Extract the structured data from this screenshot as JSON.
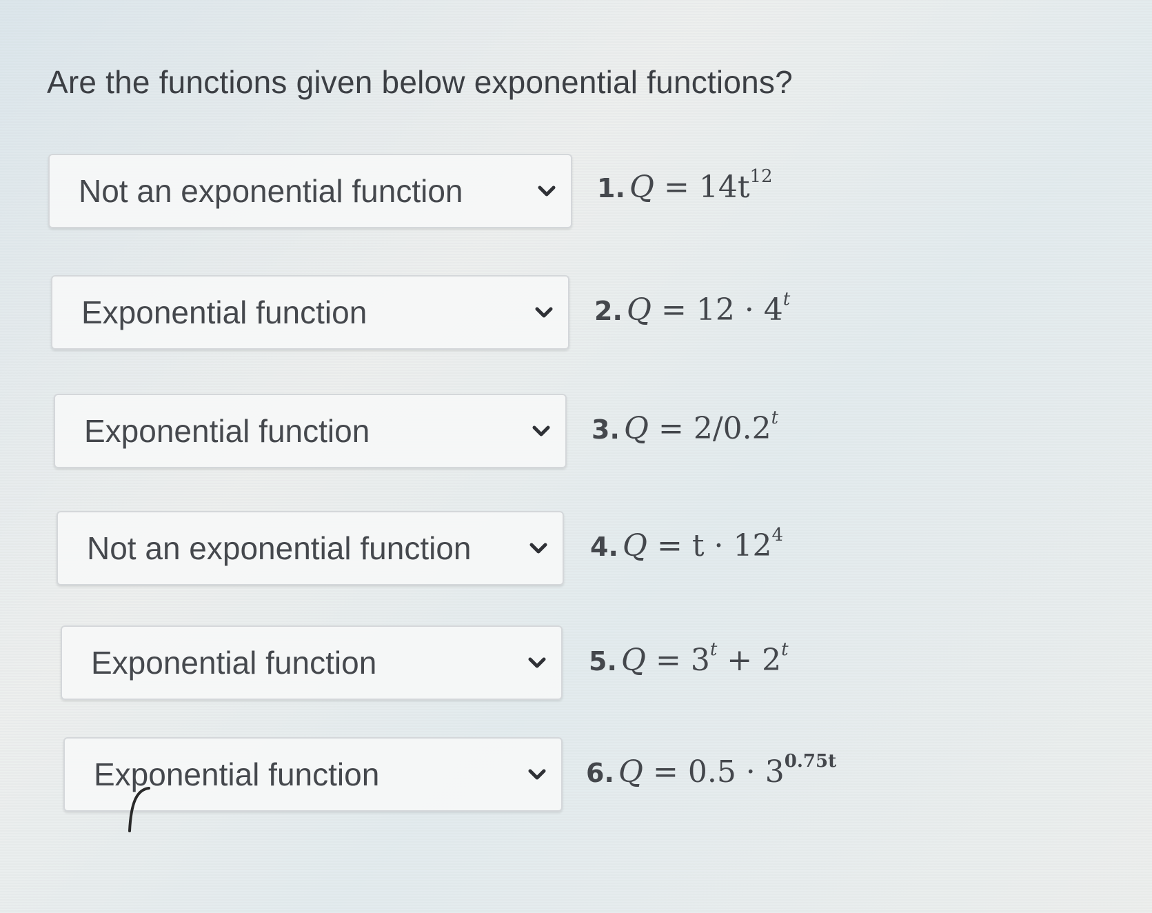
{
  "question": "Are the functions given below exponential functions?",
  "items": [
    {
      "number": "1.",
      "selected": "Not an exponential function",
      "equation": {
        "lhs": "Q",
        "eq": "=",
        "rhs_main": "14t",
        "rhs_sup": "12",
        "rhs_tail": "",
        "rhs_tail_sup": ""
      }
    },
    {
      "number": "2.",
      "selected": "Exponential function",
      "equation": {
        "lhs": "Q",
        "eq": "=",
        "rhs_main": "12 · 4",
        "rhs_sup": "t",
        "rhs_tail": "",
        "rhs_tail_sup": ""
      }
    },
    {
      "number": "3.",
      "selected": "Exponential function",
      "equation": {
        "lhs": "Q",
        "eq": "=",
        "rhs_main": "2/0.2",
        "rhs_sup": "t",
        "rhs_tail": "",
        "rhs_tail_sup": ""
      }
    },
    {
      "number": "4.",
      "selected": "Not an exponential function",
      "equation": {
        "lhs": "Q",
        "eq": "=",
        "rhs_main": "t · 12",
        "rhs_sup": "4",
        "rhs_tail": "",
        "rhs_tail_sup": ""
      }
    },
    {
      "number": "5.",
      "selected": "Exponential function",
      "equation": {
        "lhs": "Q",
        "eq": "=",
        "rhs_main": "3",
        "rhs_sup": "t",
        "rhs_tail": " + 2",
        "rhs_tail_sup": "t"
      }
    },
    {
      "number": "6.",
      "selected": "Exponential function",
      "equation": {
        "lhs": "Q",
        "eq": "=",
        "rhs_main": "0.5 · 3",
        "rhs_sup": "0.75t",
        "rhs_tail": "",
        "rhs_tail_sup": ""
      }
    }
  ],
  "icons": {
    "dropdown": "chevron-down-icon"
  },
  "colors": {
    "text": "#3c3f44",
    "select_bg": "#f6f7f7",
    "select_border": "#d4d7da",
    "chevron": "#2f3136"
  }
}
